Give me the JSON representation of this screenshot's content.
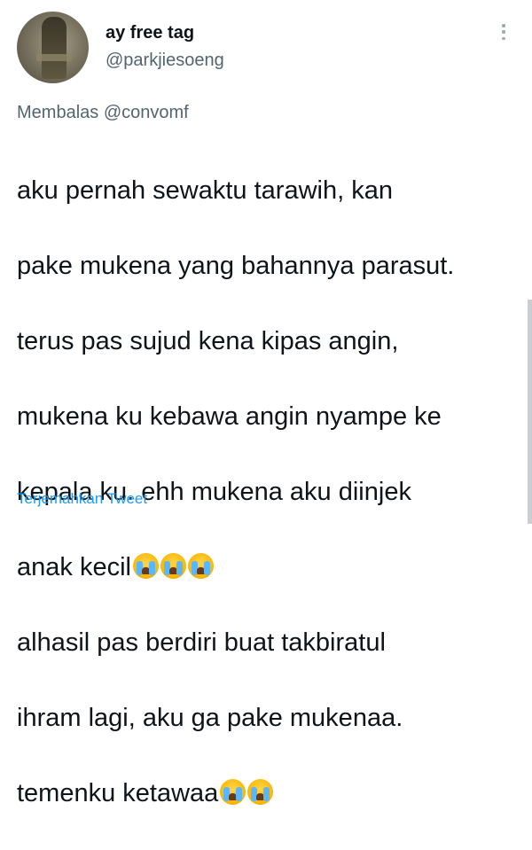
{
  "author": {
    "display_name": "ay free tag",
    "handle": "@parkjiesoeng"
  },
  "reply": {
    "prefix": "Membalas",
    "mention": "@convomf"
  },
  "tweet": {
    "lines": [
      "aku pernah sewaktu tarawih, kan",
      "pake mukena yang bahannya parasut.",
      "terus pas sujud kena kipas angin,",
      "mukena ku kebawa angin nyampe ke",
      "kepala ku. ehh mukena aku diinjek",
      "anak kecil",
      "alhasil pas berdiri buat takbiratul",
      "ihram lagi, aku ga pake mukenaa.",
      "temenku ketawaa"
    ],
    "emoji_name": "loudly-crying-face-icon"
  },
  "translate_label": "Terjemahkan Tweet",
  "colors": {
    "text": "#0f1419",
    "secondary": "#536471",
    "link": "#1d9bf0"
  }
}
